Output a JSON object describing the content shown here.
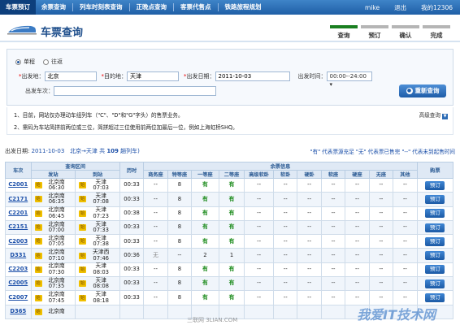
{
  "topnav": {
    "tabs": [
      "车票预订",
      "余票查询",
      "列车时刻表查询",
      "正晚点查询",
      "客票代售点",
      "铁路旅程规划"
    ],
    "user": "mike",
    "logout": "退出",
    "my12306": "我的12306"
  },
  "header": {
    "title": "车票查询",
    "steps": [
      "查询",
      "预订",
      "确认",
      "完成"
    ]
  },
  "form": {
    "oneway": "单程",
    "roundtrip": "往返",
    "from_label": "出发地：",
    "from_value": "北京",
    "to_label": "目的地：",
    "to_value": "天津",
    "date_label": "出发日期：",
    "date_value": "2011-10-03",
    "time_label": "出发时间：",
    "time_value": "00:00--24:00",
    "train_label": "出发车次：",
    "train_value": "",
    "search_button": "重新查询"
  },
  "notes": {
    "line1": "1、目前，网站仅办理动车组列车（\"C\"、\"D\"和\"G\"字头）的售票业务。",
    "line2": "2、需码为车站简拼前两位或三位，简拼超过三位使用前两位加最后一位，例如上海虹桥SHQ。",
    "advanced": "高级查询"
  },
  "summary": {
    "label": "出发日期:",
    "date": "2011-10-03",
    "route": "北京→天津",
    "count_prefix": "共",
    "count": "109",
    "count_suffix": "趟列车)",
    "legend": "\"有\" 代表票源充足  \"无\" 代表票已售完  \"--\" 代表未到起售时间"
  },
  "table": {
    "headers_top": [
      "车次",
      "查询区间",
      "历时",
      "余票信息",
      "购票"
    ],
    "headers_sub": [
      "发站",
      "到站",
      "",
      "商务座",
      "特等座",
      "一等座",
      "二等座",
      "高级软卧",
      "软卧",
      "硬卧",
      "软座",
      "硬座",
      "无座",
      "其他"
    ],
    "rows": [
      {
        "train": "C2001",
        "from": "北京南",
        "dep": "06:30",
        "to": "天津",
        "arr": "07:03",
        "dur": "00:33",
        "biz": "--",
        "special": "8",
        "first": "有",
        "second": "有",
        "book": "预订"
      },
      {
        "train": "C2171",
        "from": "北京南",
        "dep": "06:35",
        "to": "天津",
        "arr": "07:08",
        "dur": "00:33",
        "biz": "--",
        "special": "8",
        "first": "有",
        "second": "有",
        "book": "预订"
      },
      {
        "train": "C2201",
        "from": "北京南",
        "dep": "06:45",
        "to": "天津",
        "arr": "07:23",
        "dur": "00:38",
        "biz": "--",
        "special": "8",
        "first": "有",
        "second": "有",
        "book": "预订"
      },
      {
        "train": "C2151",
        "from": "北京南",
        "dep": "07:00",
        "to": "天津",
        "arr": "07:33",
        "dur": "00:33",
        "biz": "--",
        "special": "8",
        "first": "有",
        "second": "有",
        "book": "预订"
      },
      {
        "train": "C2003",
        "from": "北京南",
        "dep": "07:05",
        "to": "天津",
        "arr": "07:38",
        "dur": "00:33",
        "biz": "--",
        "special": "8",
        "first": "有",
        "second": "有",
        "book": "预订"
      },
      {
        "train": "D331",
        "from": "北京南",
        "dep": "07:10",
        "to": "天津西",
        "arr": "07:46",
        "dur": "00:36",
        "biz": "无",
        "special": "--",
        "first": "2",
        "second": "1",
        "book": "预订"
      },
      {
        "train": "C2203",
        "from": "北京南",
        "dep": "07:30",
        "to": "天津",
        "arr": "08:03",
        "dur": "00:33",
        "biz": "--",
        "special": "8",
        "first": "有",
        "second": "有",
        "book": "预订"
      },
      {
        "train": "C2005",
        "from": "北京南",
        "dep": "07:35",
        "to": "天津",
        "arr": "08:08",
        "dur": "00:33",
        "biz": "--",
        "special": "8",
        "first": "有",
        "second": "有",
        "book": "预订"
      },
      {
        "train": "C2007",
        "from": "北京南",
        "dep": "07:45",
        "to": "天津",
        "arr": "08:18",
        "dur": "00:33",
        "biz": "--",
        "special": "8",
        "first": "有",
        "second": "有",
        "book": "预订"
      },
      {
        "train": "D365",
        "from": "北京南",
        "dep": "",
        "to": "",
        "arr": "",
        "dur": "",
        "biz": "",
        "special": "",
        "first": "",
        "second": "",
        "book": ""
      }
    ]
  },
  "badge": "始",
  "watermark": "我爱IT技术网",
  "watermark_small": "三联网 3LIAN.COM"
}
